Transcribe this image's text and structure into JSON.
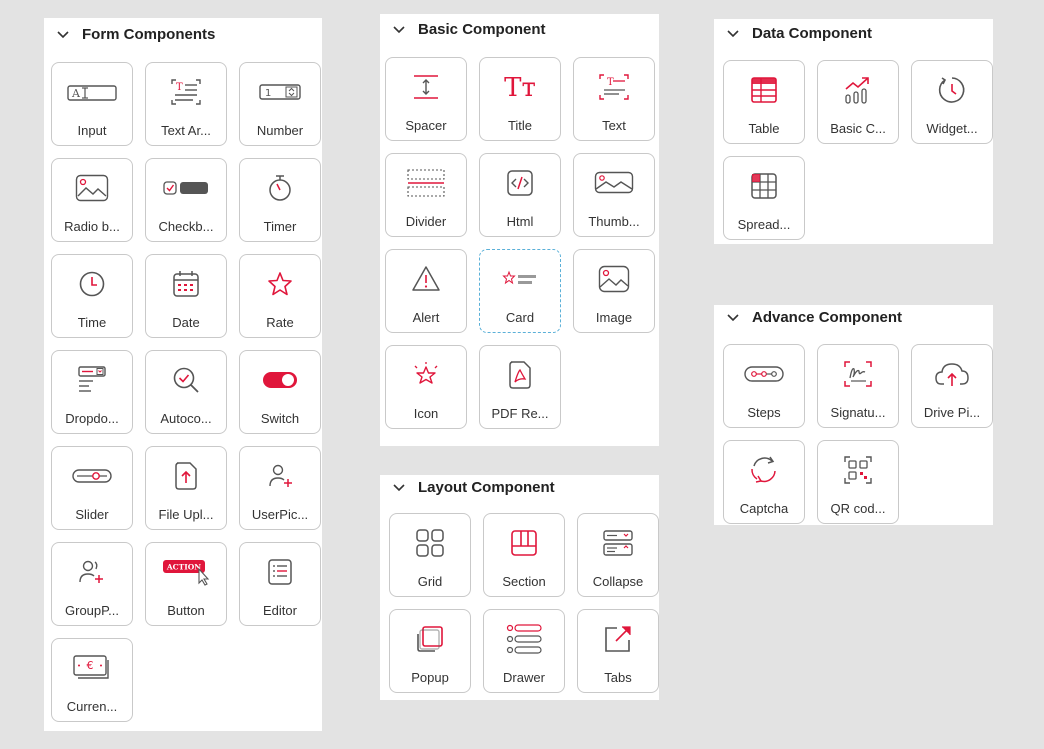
{
  "colors": {
    "accent": "#e0163b",
    "icon": "#555555",
    "border": "#c9c9c9",
    "background": "#e3e3e3"
  },
  "form": {
    "title": "Form Components",
    "items": [
      {
        "label": "Input",
        "icon": "input-icon"
      },
      {
        "label": "Text Ar...",
        "icon": "text-area-icon"
      },
      {
        "label": "Number",
        "icon": "number-icon"
      },
      {
        "label": "Radio b...",
        "icon": "radio-button-icon"
      },
      {
        "label": "Checkb...",
        "icon": "checkbox-icon"
      },
      {
        "label": "Timer",
        "icon": "timer-icon"
      },
      {
        "label": "Time",
        "icon": "time-icon"
      },
      {
        "label": "Date",
        "icon": "date-icon"
      },
      {
        "label": "Rate",
        "icon": "rate-icon"
      },
      {
        "label": "Dropdo...",
        "icon": "dropdown-icon"
      },
      {
        "label": "Autoco...",
        "icon": "autocomplete-icon"
      },
      {
        "label": "Switch",
        "icon": "switch-icon"
      },
      {
        "label": "Slider",
        "icon": "slider-icon"
      },
      {
        "label": "File Upl...",
        "icon": "file-upload-icon"
      },
      {
        "label": "UserPic...",
        "icon": "user-picker-icon"
      },
      {
        "label": "GroupP...",
        "icon": "group-picker-icon"
      },
      {
        "label": "Button",
        "icon": "button-icon",
        "badge": "ACTION"
      },
      {
        "label": "Editor",
        "icon": "editor-icon"
      },
      {
        "label": "Curren...",
        "icon": "currency-icon",
        "symbol": "€"
      }
    ]
  },
  "basic": {
    "title": "Basic Component",
    "items": [
      {
        "label": "Spacer",
        "icon": "spacer-icon"
      },
      {
        "label": "Title",
        "icon": "title-icon",
        "glyph": "Tт"
      },
      {
        "label": "Text",
        "icon": "text-icon"
      },
      {
        "label": "Divider",
        "icon": "divider-icon"
      },
      {
        "label": "Html",
        "icon": "html-icon"
      },
      {
        "label": "Thumb...",
        "icon": "thumbnail-icon"
      },
      {
        "label": "Alert",
        "icon": "alert-icon"
      },
      {
        "label": "Card",
        "icon": "card-icon"
      },
      {
        "label": "Image",
        "icon": "image-icon"
      },
      {
        "label": "Icon",
        "icon": "icon-icon"
      },
      {
        "label": "PDF Re...",
        "icon": "pdf-icon"
      }
    ]
  },
  "layout": {
    "title": "Layout Component",
    "items": [
      {
        "label": "Grid",
        "icon": "grid-icon"
      },
      {
        "label": "Section",
        "icon": "section-icon"
      },
      {
        "label": "Collapse",
        "icon": "collapse-icon"
      },
      {
        "label": "Popup",
        "icon": "popup-icon"
      },
      {
        "label": "Drawer",
        "icon": "drawer-icon"
      },
      {
        "label": "Tabs",
        "icon": "tabs-icon"
      }
    ]
  },
  "data_comp": {
    "title": "Data Component",
    "items": [
      {
        "label": "Table",
        "icon": "table-icon"
      },
      {
        "label": "Basic C...",
        "icon": "basic-chart-icon"
      },
      {
        "label": "Widget...",
        "icon": "widget-icon"
      },
      {
        "label": "Spread...",
        "icon": "spreadsheet-icon"
      }
    ]
  },
  "advance": {
    "title": "Advance Component",
    "items": [
      {
        "label": "Steps",
        "icon": "steps-icon"
      },
      {
        "label": "Signatu...",
        "icon": "signature-icon"
      },
      {
        "label": "Drive Pi...",
        "icon": "drive-picker-icon"
      },
      {
        "label": "Captcha",
        "icon": "captcha-icon"
      },
      {
        "label": "QR cod...",
        "icon": "qr-code-icon"
      }
    ]
  }
}
